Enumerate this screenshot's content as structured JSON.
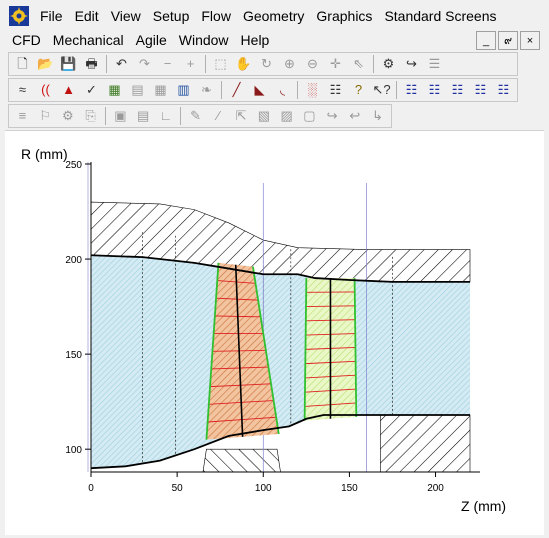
{
  "menus_row1": [
    "File",
    "Edit",
    "View",
    "Setup",
    "Flow",
    "Geometry",
    "Graphics",
    "Standard Screens"
  ],
  "menus_row2": [
    "CFD",
    "Mechanical",
    "Agile",
    "Window",
    "Help"
  ],
  "window_controls": {
    "minimize": "_",
    "restore": "๙",
    "close": "×"
  },
  "toolbar1": [
    {
      "icon": "new-file-icon",
      "glyph": "🗋"
    },
    {
      "icon": "open-folder-icon",
      "glyph": "📂"
    },
    {
      "icon": "save-icon",
      "glyph": "💾"
    },
    {
      "icon": "print-icon",
      "glyph": "🖶"
    },
    {
      "sep": true
    },
    {
      "icon": "undo-icon",
      "glyph": "↶"
    },
    {
      "icon": "redo-icon",
      "glyph": "↷",
      "disabled": true
    },
    {
      "icon": "minus-icon",
      "glyph": "−",
      "disabled": true
    },
    {
      "icon": "plus-icon",
      "glyph": "+",
      "disabled": true
    },
    {
      "sep": true
    },
    {
      "icon": "zoom-window-icon",
      "glyph": "⬚",
      "disabled": true
    },
    {
      "icon": "pan-hand-icon",
      "glyph": "✋",
      "disabled": true
    },
    {
      "icon": "rotate-icon",
      "glyph": "↻",
      "disabled": true
    },
    {
      "icon": "zoom-in-icon",
      "glyph": "⊕",
      "disabled": true
    },
    {
      "icon": "zoom-out-icon",
      "glyph": "⊖",
      "disabled": true
    },
    {
      "icon": "center-icon",
      "glyph": "✛",
      "disabled": true
    },
    {
      "icon": "select-cursor-icon",
      "glyph": "⇖",
      "disabled": true
    },
    {
      "sep": true
    },
    {
      "icon": "settings-icon",
      "glyph": "⚙"
    },
    {
      "icon": "export-icon",
      "glyph": "↪"
    },
    {
      "icon": "report-icon",
      "glyph": "☰",
      "disabled": true
    }
  ],
  "toolbar2": [
    {
      "icon": "flowpath-icon",
      "glyph": "≈"
    },
    {
      "icon": "blade-row-icon",
      "glyph": "((",
      "color": "#d01010"
    },
    {
      "icon": "stacking-icon",
      "glyph": "▲",
      "color": "#c01010"
    },
    {
      "icon": "check-icon",
      "glyph": "✓"
    },
    {
      "icon": "solve-icon",
      "glyph": "▦",
      "color": "#3a7a20"
    },
    {
      "icon": "mesh-icon",
      "glyph": "▤",
      "disabled": true
    },
    {
      "icon": "grid-icon",
      "glyph": "▦",
      "disabled": true
    },
    {
      "icon": "table-icon",
      "glyph": "▥",
      "color": "#2050a0"
    },
    {
      "icon": "tree-icon",
      "glyph": "❧",
      "disabled": true
    },
    {
      "sep": true
    },
    {
      "icon": "plot-line-icon",
      "glyph": "╱",
      "color": "#8a1a1a"
    },
    {
      "icon": "plot-blade-icon",
      "glyph": "◣",
      "color": "#8a1a1a"
    },
    {
      "icon": "plot-curve-icon",
      "glyph": "◟",
      "color": "#8a1a1a"
    },
    {
      "sep": true
    },
    {
      "icon": "chart-icon",
      "glyph": "░",
      "color": "#c02020"
    },
    {
      "icon": "document-icon",
      "glyph": "☷"
    },
    {
      "icon": "help-icon",
      "glyph": "?",
      "color": "#8a6a00"
    },
    {
      "icon": "context-help-icon",
      "glyph": "↖?"
    },
    {
      "sep": true
    },
    {
      "icon": "list-a-icon",
      "glyph": "☷",
      "color": "#2030a0"
    },
    {
      "icon": "list-b-icon",
      "glyph": "☷",
      "color": "#2030a0"
    },
    {
      "icon": "list-c-icon",
      "glyph": "☷",
      "color": "#2030a0"
    },
    {
      "icon": "list-d-icon",
      "glyph": "☷",
      "color": "#2030a0"
    },
    {
      "icon": "list-e-icon",
      "glyph": "☷",
      "color": "#2030a0"
    }
  ],
  "toolbar3": [
    {
      "icon": "align-icon",
      "glyph": "≡",
      "disabled": true
    },
    {
      "icon": "figure-icon",
      "glyph": "⚐",
      "disabled": true
    },
    {
      "icon": "wheel-icon",
      "glyph": "⚙",
      "disabled": true
    },
    {
      "icon": "copy-icon",
      "glyph": "⎘",
      "disabled": true
    },
    {
      "sep": true
    },
    {
      "icon": "cube-icon",
      "glyph": "▣",
      "disabled": true
    },
    {
      "icon": "stack-icon",
      "glyph": "▤",
      "disabled": true
    },
    {
      "icon": "axes-icon",
      "glyph": "∟",
      "disabled": true
    },
    {
      "sep": true
    },
    {
      "icon": "edit-plot-icon",
      "glyph": "✎",
      "disabled": true
    },
    {
      "icon": "edit-line-icon",
      "glyph": "⁄",
      "disabled": true
    },
    {
      "icon": "move-icon",
      "glyph": "⇱",
      "disabled": true
    },
    {
      "icon": "layer-icon",
      "glyph": "▧",
      "disabled": true
    },
    {
      "icon": "layers-icon",
      "glyph": "▨",
      "disabled": true
    },
    {
      "icon": "frame-icon",
      "glyph": "▢",
      "disabled": true
    },
    {
      "icon": "turn-a-icon",
      "glyph": "↪",
      "disabled": true
    },
    {
      "icon": "turn-b-icon",
      "glyph": "↩",
      "disabled": true
    },
    {
      "icon": "turn-c-icon",
      "glyph": "↳",
      "disabled": true
    }
  ],
  "chart_data": {
    "type": "line",
    "title": "",
    "xlabel": "Z (mm)",
    "ylabel": "R (mm)",
    "xlim": [
      0,
      220
    ],
    "ylim": [
      88,
      250
    ],
    "x_ticks": [
      0,
      50,
      100,
      150,
      200
    ],
    "y_ticks": [
      100,
      150,
      200,
      250
    ],
    "grid": false,
    "series": [
      {
        "role": "shroud",
        "points": [
          [
            0,
            202
          ],
          [
            30,
            201
          ],
          [
            60,
            198
          ],
          [
            80,
            195
          ],
          [
            100,
            192
          ],
          [
            120,
            192
          ],
          [
            130,
            190
          ],
          [
            150,
            189
          ],
          [
            175,
            188
          ],
          [
            220,
            188
          ]
        ]
      },
      {
        "role": "hub",
        "points": [
          [
            0,
            90
          ],
          [
            20,
            91
          ],
          [
            40,
            94
          ],
          [
            60,
            100
          ],
          [
            80,
            107
          ],
          [
            100,
            110
          ],
          [
            115,
            112
          ],
          [
            125,
            116
          ],
          [
            135,
            118
          ],
          [
            150,
            118
          ],
          [
            175,
            118
          ],
          [
            220,
            118
          ]
        ]
      },
      {
        "role": "blade-1",
        "leading_edge": [
          [
            74,
            198
          ],
          [
            67,
            105
          ]
        ],
        "trailing_edge": [
          [
            94,
            196
          ],
          [
            109,
            108
          ]
        ]
      },
      {
        "role": "blade-2",
        "leading_edge": [
          [
            125,
            190
          ],
          [
            124,
            115
          ]
        ],
        "trailing_edge": [
          [
            153,
            190
          ],
          [
            154,
            117
          ]
        ]
      }
    ],
    "colors": {
      "passage": "#9ecfe0",
      "blade1": "#e8a070",
      "blade2": "#d8f0a0",
      "blade_edge": "#30c030",
      "mesh": "#e02020"
    }
  }
}
